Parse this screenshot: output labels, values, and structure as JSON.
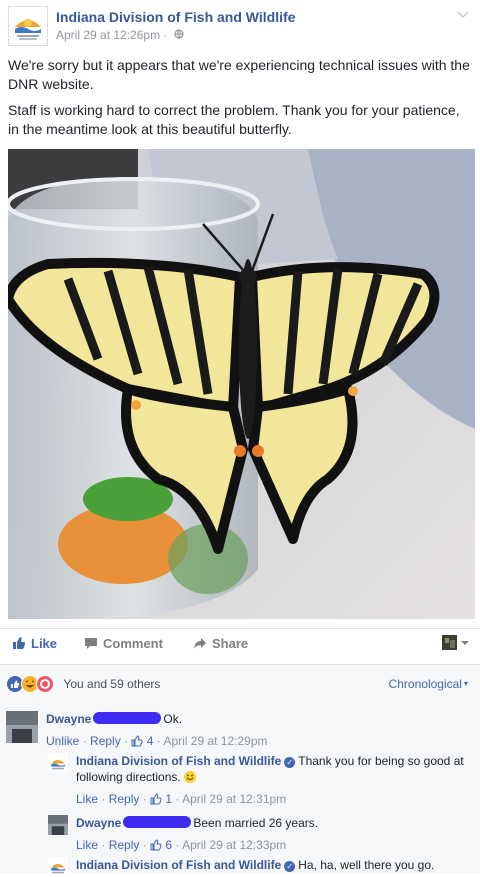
{
  "post": {
    "page_name": "Indiana Division of Fish and Wildlife",
    "timestamp": "April 29 at 12:26pm",
    "privacy_icon": "globe-icon",
    "paragraphs": [
      "We're sorry but it appears that we're experiencing technical issues with the DNR website.",
      "Staff is working hard to correct the problem. Thank you for your patience, in the meantime look at this beautiful butterfly."
    ]
  },
  "actions": {
    "like": "Like",
    "comment": "Comment",
    "share": "Share"
  },
  "reactions": {
    "summary": "You and 59 others",
    "order": "Chronological",
    "icons": [
      "like",
      "haha",
      "love"
    ]
  },
  "comments": [
    {
      "author": "Dwayne",
      "text": "Ok.",
      "action1": "Unlike",
      "reply": "Reply",
      "likes": "4",
      "time": "April 29 at 12:29pm"
    },
    {
      "author": "Indiana Division of Fish and Wildlife",
      "text": "Thank you for being so good at following directions.",
      "action1": "Like",
      "reply": "Reply",
      "likes": "1",
      "time": "April 29 at 12:31pm"
    },
    {
      "author": "Dwayne",
      "text": "Been married 26 years.",
      "action1": "Like",
      "reply": "Reply",
      "likes": "6",
      "time": "April 29 at 12:33pm"
    },
    {
      "author": "Indiana Division of Fish and Wildlife",
      "text": "Ha, ha, well there you go."
    }
  ],
  "colors": {
    "link_blue": "#365899",
    "fb_blue": "#4267b2",
    "meta_gray": "#90949c",
    "redaction": "#3e2cf3"
  }
}
